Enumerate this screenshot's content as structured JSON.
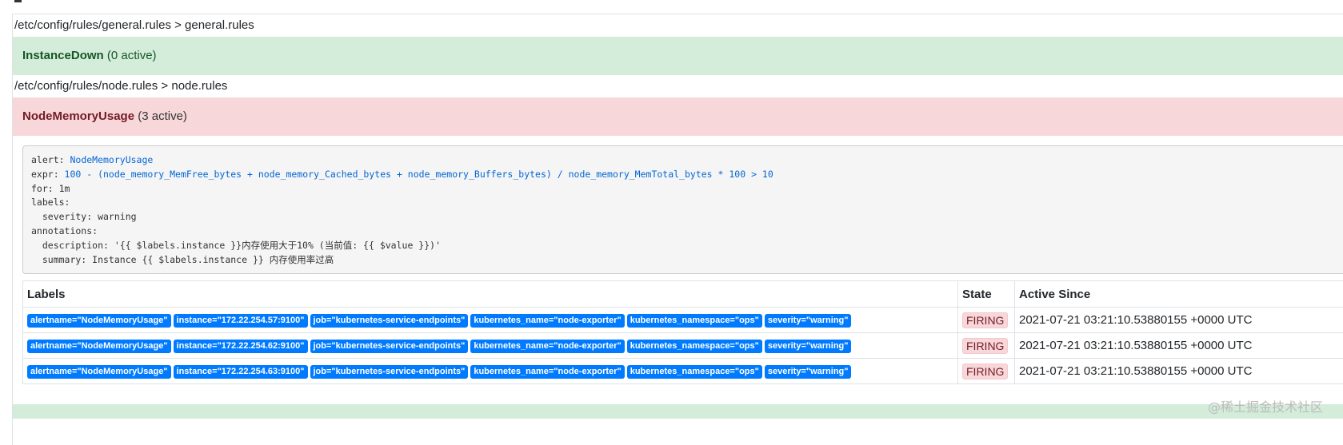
{
  "groups": [
    {
      "path": "/etc/config/rules/general.rules > general.rules",
      "rule": {
        "name": "InstanceDown",
        "count": "(0 active)",
        "color": "#d4edda"
      }
    },
    {
      "path": "/etc/config/rules/node.rules > node.rules",
      "rule": {
        "name": "NodeMemoryUsage",
        "count": "(3 active)",
        "color": "#f8d7da"
      }
    }
  ],
  "definition": {
    "lines": [
      {
        "key": "alert: ",
        "value": "NodeMemoryUsage"
      },
      {
        "key": "expr: ",
        "value": "100 - (node_memory_MemFree_bytes + node_memory_Cached_bytes + node_memory_Buffers_bytes) / node_memory_MemTotal_bytes * 100 > 10"
      },
      {
        "key": "for: 1m",
        "value": ""
      },
      {
        "key": "labels:",
        "value": ""
      },
      {
        "key": "  severity: warning",
        "value": ""
      },
      {
        "key": "annotations:",
        "value": ""
      },
      {
        "key": "  description: '{{ $labels.instance }}内存使用大于10% (当前值: {{ $value }})'",
        "value": ""
      },
      {
        "key": "  summary: Instance {{ $labels.instance }} 内存使用率过高",
        "value": ""
      }
    ]
  },
  "table": {
    "headers": [
      "Labels",
      "State",
      "Active Since"
    ],
    "rows": [
      {
        "labels": [
          "alertname=\"NodeMemoryUsage\"",
          "instance=\"172.22.254.57:9100\"",
          "job=\"kubernetes-service-endpoints\"",
          "kubernetes_name=\"node-exporter\"",
          "kubernetes_namespace=\"ops\"",
          "severity=\"warning\""
        ],
        "state": "FIRING",
        "since": "2021-07-21 03:21:10.53880155 +0000 UTC"
      },
      {
        "labels": [
          "alertname=\"NodeMemoryUsage\"",
          "instance=\"172.22.254.62:9100\"",
          "job=\"kubernetes-service-endpoints\"",
          "kubernetes_name=\"node-exporter\"",
          "kubernetes_namespace=\"ops\"",
          "severity=\"warning\""
        ],
        "state": "FIRING",
        "since": "2021-07-21 03:21:10.53880155 +0000 UTC"
      },
      {
        "labels": [
          "alertname=\"NodeMemoryUsage\"",
          "instance=\"172.22.254.63:9100\"",
          "job=\"kubernetes-service-endpoints\"",
          "kubernetes_name=\"node-exporter\"",
          "kubernetes_namespace=\"ops\"",
          "severity=\"warning\""
        ],
        "state": "FIRING",
        "since": "2021-07-21 03:21:10.53880155 +0000 UTC"
      }
    ]
  },
  "watermark": "@稀土掘金技术社区",
  "colors": {
    "label": "#007bff",
    "firing": "#721c24",
    "ok": "#155724",
    "next_group": "#d4edda"
  }
}
